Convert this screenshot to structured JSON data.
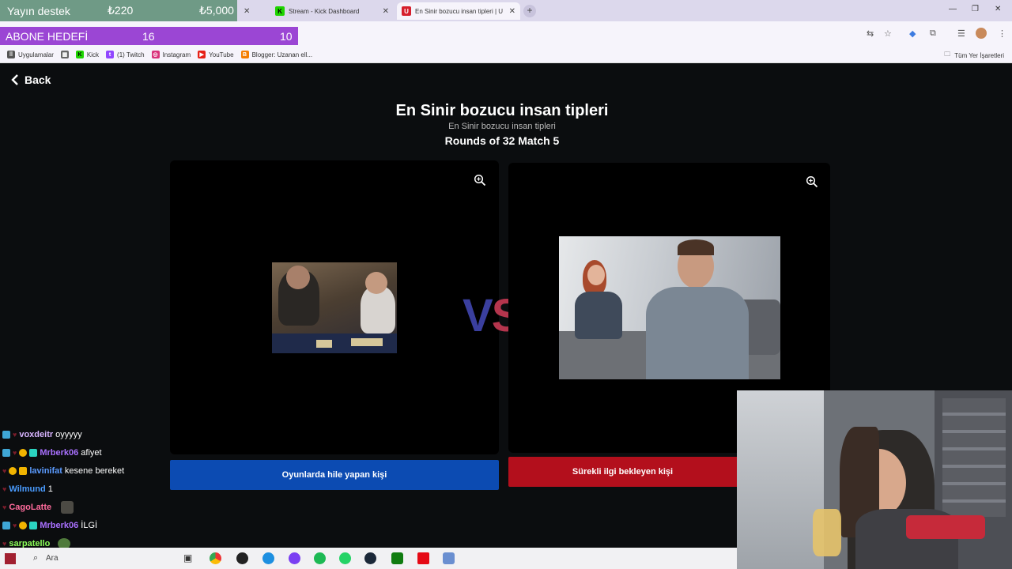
{
  "overlay": {
    "donation_label": "Yayın destek",
    "donation_amount": "₺220",
    "donation_goal": "₺5,000",
    "sub_goal_label": "ABONE HEDEFİ",
    "sub_goal_current": "16",
    "sub_goal_target": "10"
  },
  "browser": {
    "tabs": [
      {
        "label": "Stream - Kick Dashboard",
        "favicon": "kick-icon"
      },
      {
        "label": "En Sinir bozucu insan tipleri | U",
        "favicon": "u-icon"
      }
    ],
    "bookmarks": [
      "Uygulamalar",
      "Kick",
      "(1) Twitch",
      "Instagram",
      "YouTube",
      "Blogger: Uzanan ell..."
    ],
    "all_bookmarks": "Tüm Yer İşaretleri"
  },
  "page": {
    "back_label": "Back",
    "title": "En Sinir bozucu insan tipleri",
    "subtitle": "En Sinir bozucu insan tipleri",
    "round": "Rounds of 32 Match 5",
    "vs_v": "V",
    "vs_s": "S",
    "left_choice": "Oyunlarda hile yapan kişi",
    "right_choice": "Sürekli ilgi bekleyen kişi"
  },
  "chat": [
    {
      "user": "voxdeitr",
      "msg": "oyyyyy",
      "color": "#d8b4ff"
    },
    {
      "user": "Mrberk06",
      "msg": "afiyet",
      "color": "#a970ff"
    },
    {
      "user": "lavinifat",
      "msg": "kesene bereket",
      "color": "#5b9bff"
    },
    {
      "user": "Wilmund",
      "msg": "1",
      "color": "#4a9cff"
    },
    {
      "user": "CagoLatte",
      "msg": "",
      "color": "#ff6b9c"
    },
    {
      "user": "Mrberk06",
      "msg": "İLGİ",
      "color": "#a970ff"
    },
    {
      "user": "sarpatello",
      "msg": "",
      "color": "#8cff5a"
    }
  ],
  "taskbar": {
    "search_label": "Ara"
  },
  "colors": {
    "left_button": "#0c4bb2",
    "right_button": "#b30f1c",
    "sub_goal": "#9b46d4",
    "donation": "#6f9a86"
  }
}
